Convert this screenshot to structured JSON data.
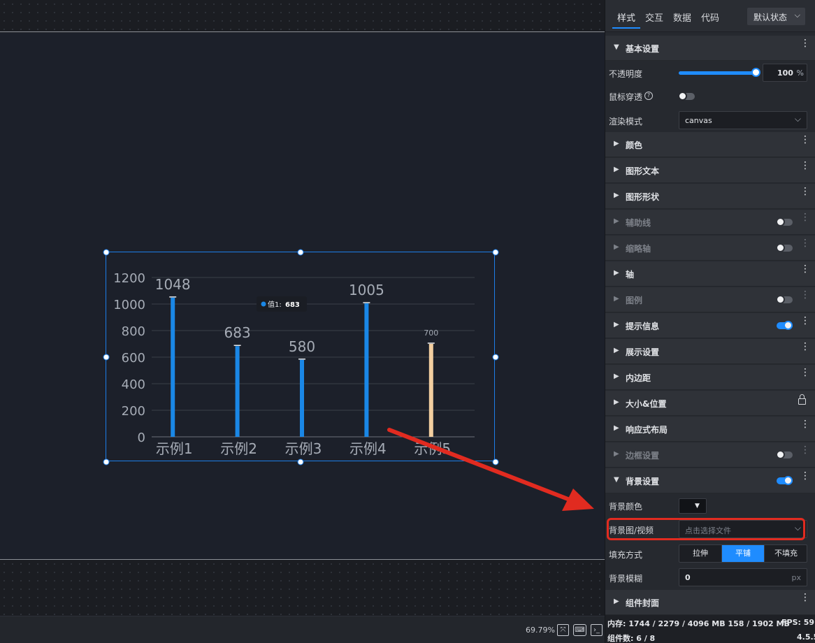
{
  "panel": {
    "tabs": [
      "样式",
      "交互",
      "数据",
      "代码"
    ],
    "state_select": "默认状态",
    "basic_section": "基本设置",
    "opacity_label": "不透明度",
    "opacity_value": "100",
    "opacity_unit": "%",
    "opacity_fraction": 1.0,
    "mouse_pass_label": "鼠标穿透",
    "render_mode_label": "渲染模式",
    "render_mode_value": "canvas",
    "sections": [
      {
        "label": "颜色",
        "disabled": false,
        "toggle": null
      },
      {
        "label": "图形文本",
        "disabled": false,
        "toggle": null
      },
      {
        "label": "图形形状",
        "disabled": false,
        "toggle": null
      },
      {
        "label": "辅助线",
        "disabled": true,
        "toggle": "off"
      },
      {
        "label": "缩略轴",
        "disabled": true,
        "toggle": "off"
      },
      {
        "label": "轴",
        "disabled": false,
        "toggle": null
      },
      {
        "label": "图例",
        "disabled": true,
        "toggle": "off"
      },
      {
        "label": "提示信息",
        "disabled": false,
        "toggle": "on"
      },
      {
        "label": "展示设置",
        "disabled": false,
        "toggle": null
      },
      {
        "label": "内边距",
        "disabled": false,
        "toggle": null
      },
      {
        "label": "大小&位置",
        "disabled": false,
        "toggle": null,
        "icon": "lock-icon"
      },
      {
        "label": "响应式布局",
        "disabled": false,
        "toggle": null
      },
      {
        "label": "边框设置",
        "disabled": true,
        "toggle": "off"
      },
      {
        "label": "背景设置",
        "disabled": false,
        "toggle": "on",
        "expanded": true
      }
    ],
    "bg_color_label": "背景颜色",
    "bg_media_label": "背景图/视频",
    "bg_media_placeholder": "点击选择文件",
    "fill_mode_label": "填充方式",
    "fill_modes": [
      "拉伸",
      "平铺",
      "不填充"
    ],
    "fill_mode_active": "平铺",
    "blur_label": "背景模糊",
    "blur_value": "0",
    "blur_unit": "px",
    "cover_section": "组件封面",
    "footer": {
      "memory": "内存:  1744 / 2279 / 4096 MB  158 / 1902 MB",
      "fps": "FPS:  59",
      "components": "组件数: 6 / 8",
      "version": "4.5.5"
    }
  },
  "status_bar": {
    "zoom": "69.79%"
  },
  "colors": {
    "accent": "#1f8cff",
    "bar": "#1a87e6",
    "bar_highlight": "#f3cfa0",
    "annotation": "#e12b20"
  },
  "chart_data": {
    "type": "bar",
    "categories": [
      "示例1",
      "示例2",
      "示例3",
      "示例4",
      "示例5"
    ],
    "values": [
      1048,
      683,
      580,
      1005,
      700
    ],
    "data_labels": [
      "1048",
      "683",
      "580",
      "1005",
      "700"
    ],
    "y_ticks": [
      "0",
      "200",
      "400",
      "600",
      "800",
      "1000",
      "1200"
    ],
    "ylim": [
      0,
      1200
    ],
    "grid": true,
    "highlighted_index": 4,
    "tooltip": {
      "label": "值1:",
      "value": "683"
    }
  }
}
